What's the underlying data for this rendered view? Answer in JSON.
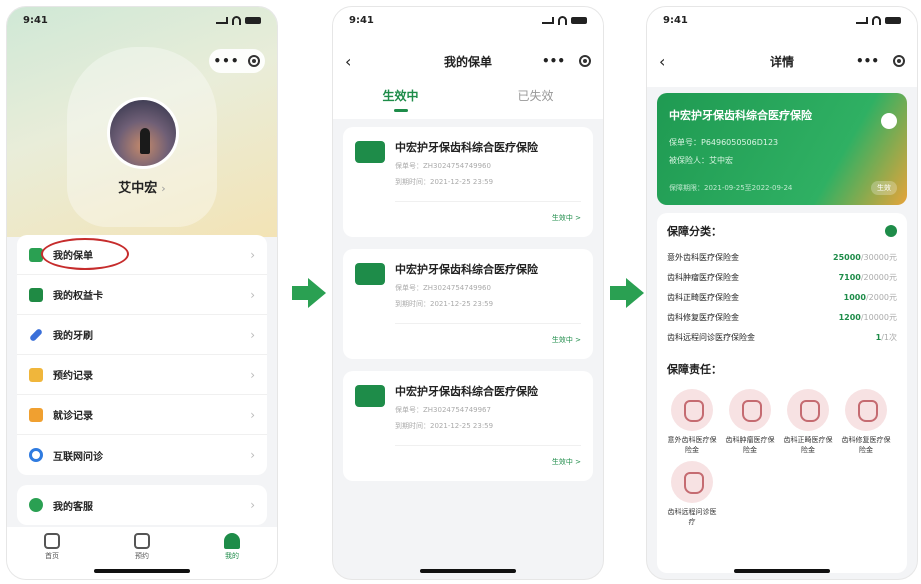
{
  "status_time": "9:41",
  "screen1": {
    "username": "艾中宏",
    "menu": [
      {
        "label": "我的保单",
        "icon": "shield-icon"
      },
      {
        "label": "我的权益卡",
        "icon": "card-icon"
      },
      {
        "label": "我的牙刷",
        "icon": "toothbrush-icon"
      },
      {
        "label": "预约记录",
        "icon": "calendar-icon"
      },
      {
        "label": "就诊记录",
        "icon": "record-icon"
      },
      {
        "label": "互联网问诊",
        "icon": "online-consult-icon"
      }
    ],
    "service": "我的客服",
    "tabs": [
      "首页",
      "预约",
      "我的"
    ]
  },
  "screen2": {
    "title": "我的保单",
    "tab_active": "生效中",
    "tab_inactive": "已失效",
    "policies": [
      {
        "name": "中宏护牙保齿科综合医疗保险",
        "policy_no": "保单号：ZH3024754749960",
        "expiry": "到期时间：2021-12-25 23:59",
        "status": "生效中 >"
      },
      {
        "name": "中宏护牙保齿科综合医疗保险",
        "policy_no": "保单号：ZH3024754749960",
        "expiry": "到期时间：2021-12-25 23:59",
        "status": "生效中 >"
      },
      {
        "name": "中宏护牙保齿科综合医疗保险",
        "policy_no": "保单号：ZH3024754749967",
        "expiry": "到期时间：2021-12-25 23:59",
        "status": "生效中 >"
      }
    ]
  },
  "screen3": {
    "title": "详情",
    "card_title": "中宏护牙保齿科综合医疗保险",
    "card_policy_no": "保单号：P6496050506D123",
    "card_insured": "被保险人：艾中宏",
    "card_period": "保障期限：2021-09-25至2022-09-24",
    "card_status": "生效",
    "coverage_title": "保障分类：",
    "coverage": [
      {
        "label": "意外齿科医疗保险金",
        "amount": "25000",
        "unit": "/30000元"
      },
      {
        "label": "齿科肿瘤医疗保险金",
        "amount": "7100",
        "unit": "/20000元"
      },
      {
        "label": "齿科正畸医疗保险金",
        "amount": "1000",
        "unit": "/2000元"
      },
      {
        "label": "齿科修复医疗保险金",
        "amount": "1200",
        "unit": "/10000元"
      },
      {
        "label": "齿科远程问诊医疗保险金",
        "amount": "1",
        "unit": "/1次"
      }
    ],
    "responsibility_title": "保障责任：",
    "responsibilities": [
      "意外齿科医疗保险金",
      "齿科肿瘤医疗保险金",
      "齿科正畸医疗保险金",
      "齿科修复医疗保险金",
      "齿科远程问诊医疗"
    ]
  }
}
